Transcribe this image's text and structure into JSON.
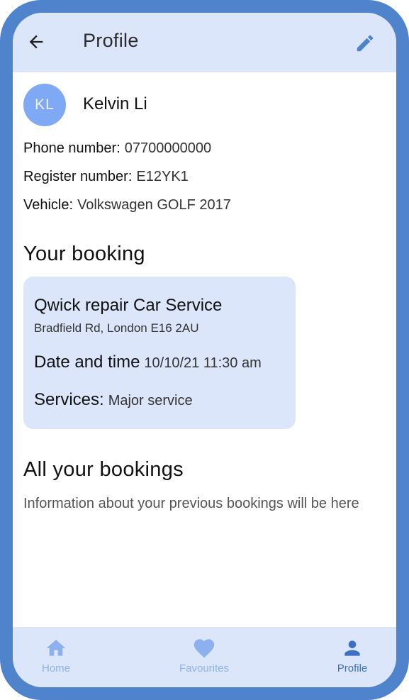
{
  "app_bar": {
    "title": "Profile",
    "back_icon": "arrow-back-icon",
    "edit_icon": "pencil-icon"
  },
  "user": {
    "initials": "KL",
    "name": "Kelvin Li",
    "details": [
      {
        "label": "Phone number:",
        "value": "07700000000"
      },
      {
        "label": "Register number:",
        "value": "E12YK1"
      },
      {
        "label": "Vehicle:",
        "value": "Volkswagen GOLF 2017"
      }
    ]
  },
  "current_booking": {
    "heading": "Your booking",
    "shop_name": "Qwick repair Car Service",
    "address": "Bradfield Rd, London E16 2AU",
    "datetime_label": "Date and time",
    "datetime_value": "10/10/21 11:30 am",
    "services_label": "Services:",
    "services_value": "Major service"
  },
  "history": {
    "heading": "All your bookings",
    "placeholder": "Information about your previous bookings will be here"
  },
  "bottom_nav": [
    {
      "label": "Home",
      "icon": "home-icon",
      "active": false
    },
    {
      "label": "Favourites",
      "icon": "heart-icon",
      "active": false
    },
    {
      "label": "Profile",
      "icon": "person-icon",
      "active": true
    }
  ],
  "colors": {
    "frame": "#4f83cc",
    "surface": "#dce6fb",
    "avatar": "#7fa8f5",
    "nav_active": "#3d6fc4",
    "nav_inactive": "#8db0ef"
  }
}
